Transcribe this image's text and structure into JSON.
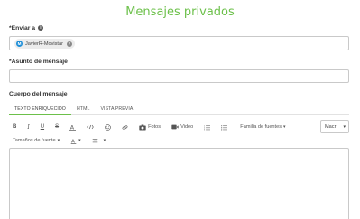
{
  "page": {
    "title": "Mensajes privados",
    "accent_color": "#6cc04a"
  },
  "to": {
    "label": "*Enviar a",
    "info_icon": "info-icon",
    "recipient_chip": {
      "name": "JavierR-Movistar",
      "logo_icon": "movistar-logo-icon",
      "logo_glyph": "M",
      "remove_icon": "close-icon"
    }
  },
  "subject": {
    "label": "*Asunto de mensaje",
    "value": ""
  },
  "body": {
    "label": "Cuerpo del mensaje",
    "tabs": [
      {
        "label": "TEXTO ENRIQUECIDO",
        "active": true
      },
      {
        "label": "HTML",
        "active": false
      },
      {
        "label": "VISTA PREVIA",
        "active": false
      }
    ],
    "toolbar": {
      "bold": "B",
      "italic": "I",
      "underline": "U",
      "strike": "S",
      "photos": "Fotos",
      "video": "Video",
      "font_family": "Familia de fuentes",
      "font_size": "Tamaños de fuente",
      "style_select_value": "Macr"
    },
    "value": ""
  }
}
